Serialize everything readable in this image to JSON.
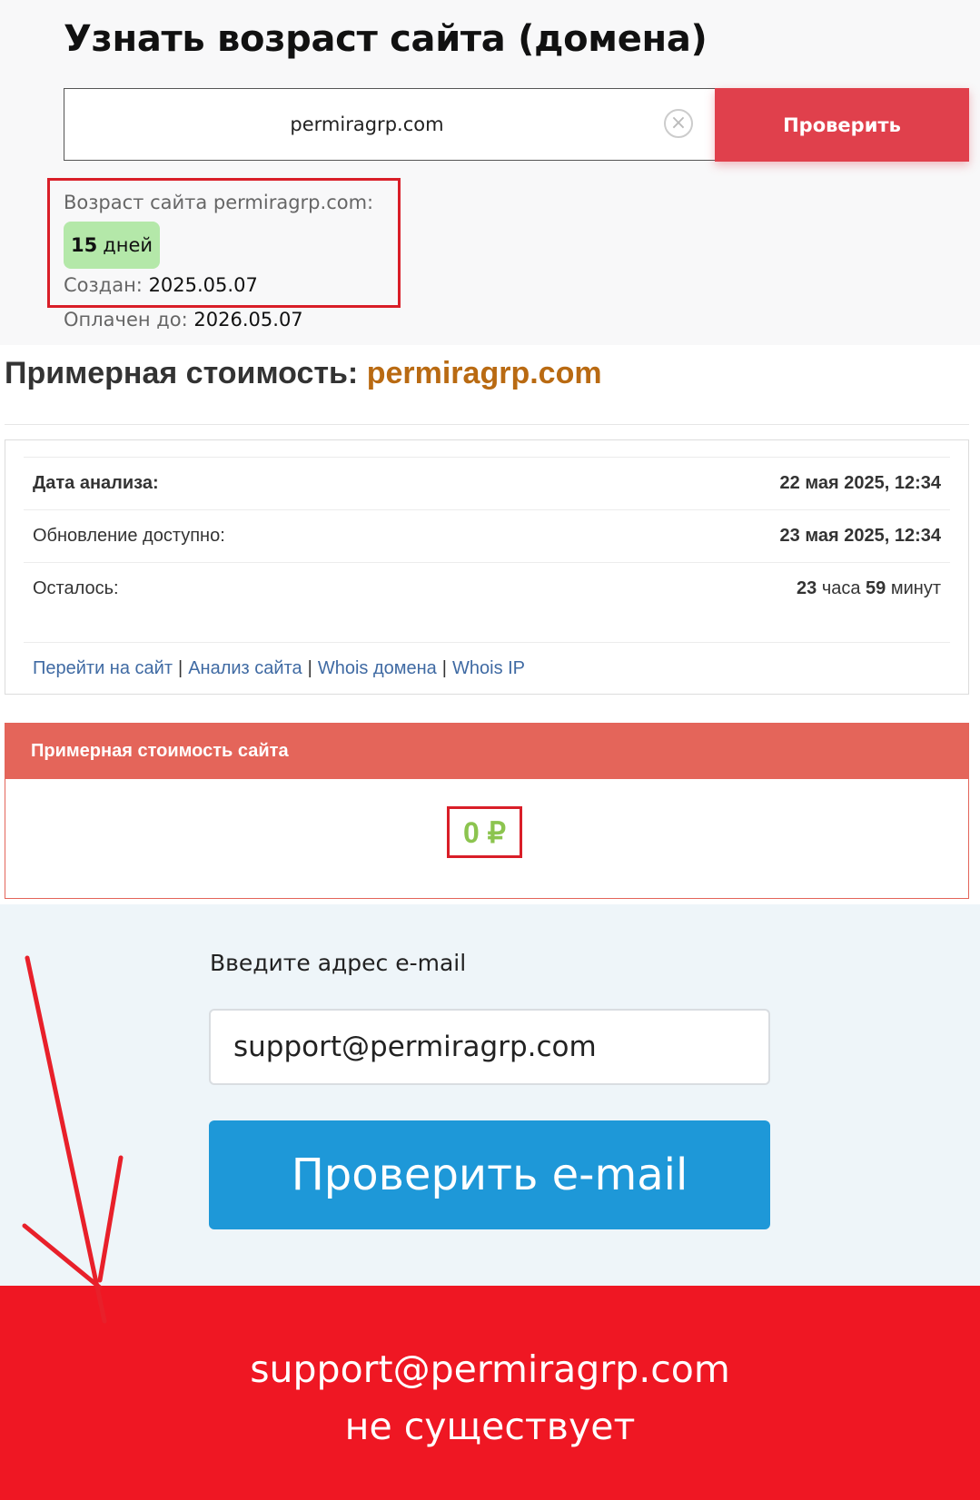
{
  "age_section": {
    "title": "Узнать возраст сайта (домена)",
    "domain_input_value": "permiragrp.com",
    "clear_glyph": "×",
    "check_button": "Проверить",
    "age_label": "Возраст сайта permiragrp.com:",
    "age_number": "15",
    "age_unit": "дней",
    "created_label": "Создан:",
    "created_value": "2025.05.07",
    "paid_label": "Оплачен до:",
    "paid_value": "2026.05.07"
  },
  "cost_section": {
    "heading_prefix": "Примерная стоимость:",
    "heading_domain": "permiragrp.com",
    "rows": [
      {
        "label": "Дата анализа:",
        "value": "22 мая 2025, 12:34"
      },
      {
        "label": "Обновление доступно:",
        "value": "23 мая 2025, 12:34"
      },
      {
        "label": "Осталось:",
        "hours": "23",
        "hours_unit": "часа",
        "minutes": "59",
        "minutes_unit": "минут"
      }
    ],
    "links": [
      "Перейти на сайт",
      "Анализ сайта",
      "Whois домена",
      "Whois IP"
    ],
    "link_separator": "|",
    "panel_title": "Примерная стоимость сайта",
    "amount": "0 ₽"
  },
  "email_section": {
    "label": "Введите адрес e-mail",
    "input_value": "support@permiragrp.com",
    "button": "Проверить e-mail"
  },
  "result": {
    "email": "support@permiragrp.com",
    "text": "не существует"
  },
  "colors": {
    "check_button": "#e0404c",
    "highlight_border": "#d91e28",
    "age_badge": "#b4e8a9",
    "domain_accent": "#b96a12",
    "link": "#3f6aa3",
    "panel_header": "#e4655a",
    "amount": "#8cc44f",
    "email_button": "#1e98d8",
    "result_banner": "#ef1723",
    "arrow": "#e8202a"
  },
  "annotation": {
    "icon": "arrow-down-icon"
  }
}
